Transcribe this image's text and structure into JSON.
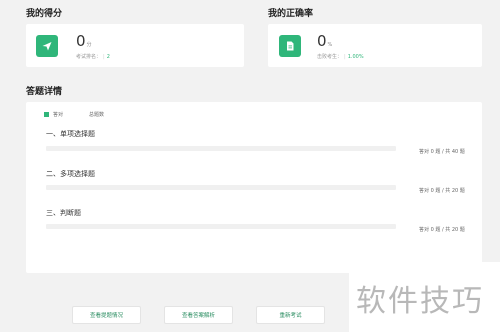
{
  "score_section": {
    "title": "我的得分",
    "value": "0",
    "unit": "分",
    "sub_label": "考试排名：",
    "sub_value": "2",
    "icon": "send-icon",
    "icon_color": "#2fb67a"
  },
  "accuracy_section": {
    "title": "我的正确率",
    "value": "0",
    "unit": "%",
    "sub_label": "击败考生：",
    "sub_value": "1.00%",
    "icon": "document-icon",
    "icon_color": "#2fb67a"
  },
  "details": {
    "title": "答题详情",
    "legend": {
      "correct": "答对",
      "total": "总题数"
    },
    "groups": [
      {
        "title": "一、单项选择题",
        "stat": "答对 0 题 / 共 40 题",
        "correct_fraction": 0
      },
      {
        "title": "二、多项选择题",
        "stat": "答对 0 题 / 共 20 题",
        "correct_fraction": 0
      },
      {
        "title": "三、判断题",
        "stat": "答对 0 题 / 共 20 题",
        "correct_fraction": 0
      }
    ]
  },
  "actions": {
    "view_answers": "查看提题情况",
    "view_analysis": "查看答案解析",
    "retake": "重新考试"
  },
  "watermark": "软件技巧",
  "colors": {
    "accent": "#2fb67a",
    "background": "#f2f2f2"
  }
}
